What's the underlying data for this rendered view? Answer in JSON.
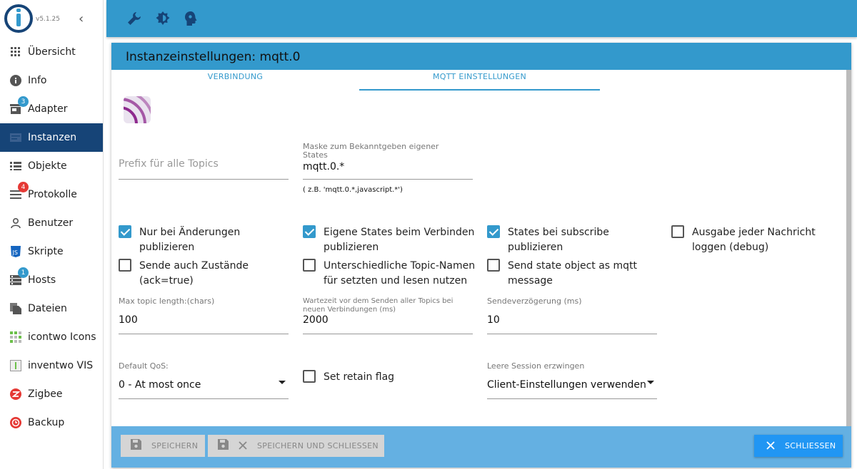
{
  "sidebar": {
    "version": "v5.1.25",
    "items": [
      {
        "label": "Übersicht",
        "icon": "grid-icon"
      },
      {
        "label": "Info",
        "icon": "info-icon"
      },
      {
        "label": "Adapter",
        "icon": "store-icon",
        "badge": "3"
      },
      {
        "label": "Instanzen",
        "icon": "instances-icon"
      },
      {
        "label": "Objekte",
        "icon": "list-icon"
      },
      {
        "label": "Protokolle",
        "icon": "log-icon",
        "badge": "4"
      },
      {
        "label": "Benutzer",
        "icon": "user-icon"
      },
      {
        "label": "Skripte",
        "icon": "js-icon"
      },
      {
        "label": "Hosts",
        "icon": "hosts-icon",
        "badge": "1"
      },
      {
        "label": "Dateien",
        "icon": "files-icon"
      },
      {
        "label": "icontwo Icons",
        "icon": "icontwo-icon"
      },
      {
        "label": "inventwo VIS",
        "icon": "inventwo-icon"
      },
      {
        "label": "Zigbee",
        "icon": "zigbee-icon"
      },
      {
        "label": "Backup",
        "icon": "backup-icon"
      }
    ]
  },
  "dialog": {
    "title": "Instanzeinstellungen: mqtt.0",
    "tabs": [
      "VERBINDUNG",
      "MQTT EINSTELLUNGEN"
    ],
    "prefix": {
      "placeholder": "Prefix für alle Topics"
    },
    "mask": {
      "label": "Maske zum Bekanntgeben eigener States",
      "value": "mqtt.0.*",
      "hint": "( z.B. 'mqtt.0.*,javascript.*')"
    },
    "checkboxes": [
      {
        "label": "Nur bei Änderungen publizieren",
        "checked": true
      },
      {
        "label": "Eigene States beim Verbinden publizieren",
        "checked": true
      },
      {
        "label": "States bei subscribe publizieren",
        "checked": true
      },
      {
        "label": "Ausgabe jeder Nachricht loggen (debug)",
        "checked": false
      },
      {
        "label": "Sende auch Zustände (ack=true)",
        "checked": false
      },
      {
        "label": "Unterschiedliche Topic-Namen für setzten und lesen nutzen",
        "checked": false
      },
      {
        "label": "Send state object as mqtt message",
        "checked": false
      }
    ],
    "max_topic": {
      "label": "Max topic length:(chars)",
      "value": "100"
    },
    "wait_time": {
      "label": "Wartezeit vor dem Senden aller Topics bei neuen Verbindungen (ms)",
      "value": "2000"
    },
    "send_delay": {
      "label": "Sendeverzögerung (ms)",
      "value": "10"
    },
    "qos": {
      "label": "Default QoS:",
      "value": "0 - At most once"
    },
    "retain": {
      "label": "Set retain flag",
      "checked": false
    },
    "session": {
      "label": "Leere Session erzwingen",
      "value": "Client-Einstellungen verwenden"
    },
    "footer": {
      "save": "SPEICHERN",
      "save_close": "SPEICHERN UND SCHLIESSEN",
      "close": "SCHLIESSEN"
    }
  }
}
